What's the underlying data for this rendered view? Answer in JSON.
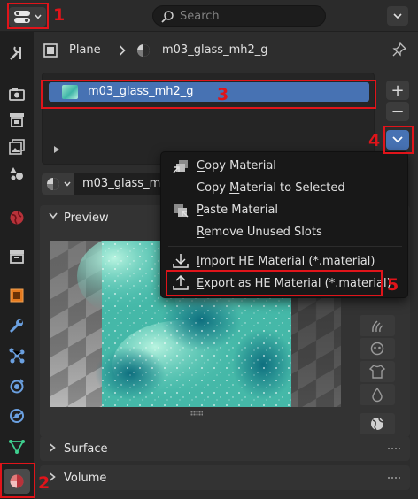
{
  "header": {
    "search_placeholder": "Search"
  },
  "breadcrumb": {
    "object": "Plane",
    "material": "m03_glass_mh2_g"
  },
  "slot_list": {
    "items": [
      {
        "label": "m03_glass_mh2_g"
      }
    ],
    "add_label": "+",
    "remove_label": "−"
  },
  "material_selector": {
    "name": "m03_glass_m"
  },
  "panels": {
    "preview": "Preview",
    "surface": "Surface",
    "volume": "Volume"
  },
  "context_menu": {
    "items": [
      {
        "pre": "",
        "ul": "C",
        "post": "opy Material"
      },
      {
        "pre": "Copy ",
        "ul": "M",
        "post": "aterial to Selected"
      },
      {
        "pre": "",
        "ul": "P",
        "post": "aste Material"
      },
      {
        "pre": "",
        "ul": "R",
        "post": "emove Unused Slots"
      },
      {
        "pre": "",
        "ul": "I",
        "post": "mport HE Material (*.material)"
      },
      {
        "pre": "",
        "ul": "E",
        "post": "xport as HE Material (*.material)"
      }
    ]
  },
  "annotations": [
    "1",
    "2",
    "3",
    "4",
    "5"
  ],
  "colors": {
    "selection": "#4772b3",
    "annotation": "#e0141a",
    "background": "#2d2d2d"
  }
}
